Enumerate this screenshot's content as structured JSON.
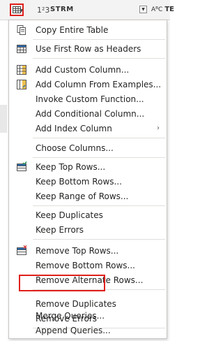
{
  "header": {
    "column_type": "1²3",
    "column_name": "STRM",
    "next_column_type": "AᴮC",
    "next_column_name": "TE"
  },
  "menu": {
    "items": [
      {
        "label": "Copy Entire Table",
        "icon": "copy-icon"
      },
      {
        "label": "Use First Row as Headers",
        "icon": "table-headers-icon"
      },
      {
        "label": "Add Custom Column...",
        "icon": "custom-column-icon"
      },
      {
        "label": "Add Column From Examples...",
        "icon": "column-from-examples-icon"
      },
      {
        "label": "Invoke Custom Function..."
      },
      {
        "label": "Add Conditional Column..."
      },
      {
        "label": "Add Index Column",
        "submenu": "›"
      },
      {
        "label": "Choose Columns..."
      },
      {
        "label": "Keep Top Rows...",
        "icon": "keep-rows-icon"
      },
      {
        "label": "Keep Bottom Rows..."
      },
      {
        "label": "Keep Range of Rows..."
      },
      {
        "label": "Keep Duplicates"
      },
      {
        "label": "Keep Errors"
      },
      {
        "label": "Remove Top Rows...",
        "icon": "remove-rows-icon"
      },
      {
        "label": "Remove Bottom Rows..."
      },
      {
        "label": "Remove Alternate Rows..."
      },
      {
        "label": "Remove Duplicates"
      },
      {
        "label": "Remove Errors"
      },
      {
        "label": "Merge Queries..."
      },
      {
        "label": "Append Queries..."
      }
    ]
  },
  "colors": {
    "highlight": "#e0201b",
    "icon_blue": "#2b6cb0",
    "icon_green": "#2e8b57",
    "icon_red": "#d83b3b"
  }
}
